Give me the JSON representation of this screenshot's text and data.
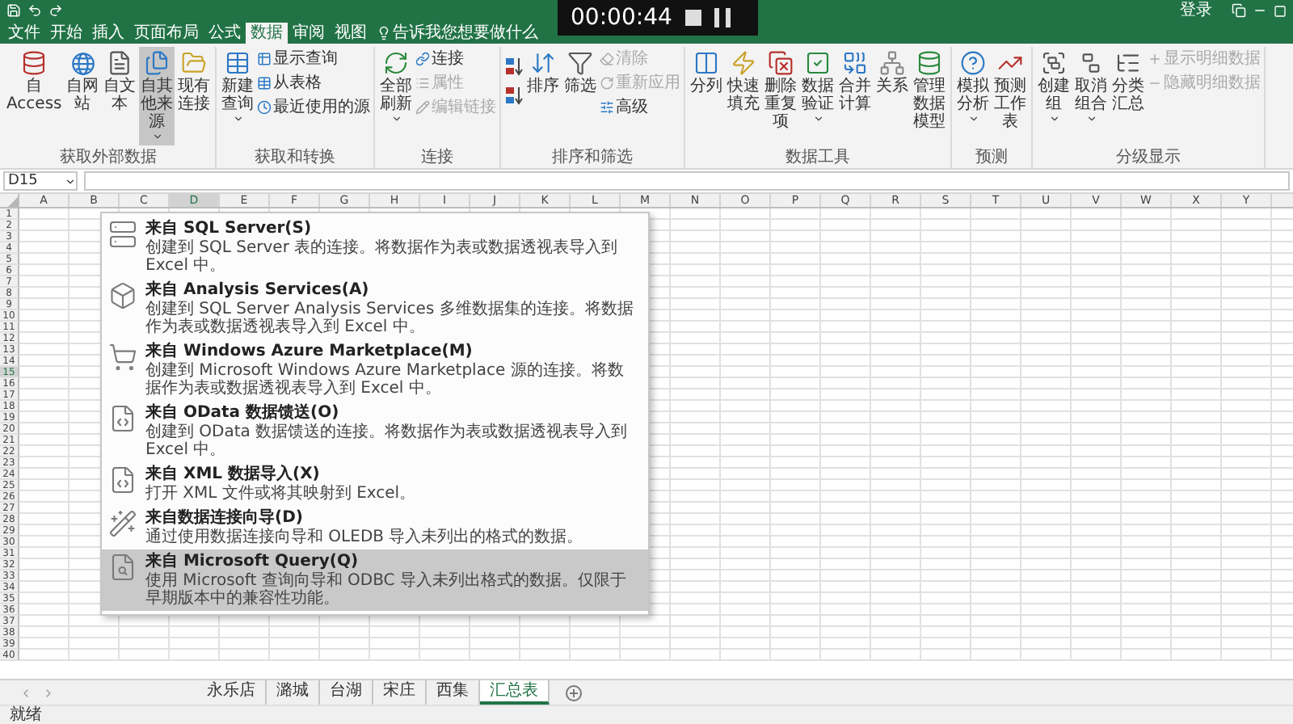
{
  "video_overlay": {
    "time": "00:00:44"
  },
  "title_bar": {
    "sign_in": "登录"
  },
  "ribbon_tabs": [
    {
      "label": "文件",
      "selected": false
    },
    {
      "label": "开始",
      "selected": false
    },
    {
      "label": "插入",
      "selected": false
    },
    {
      "label": "页面布局",
      "selected": false
    },
    {
      "label": "公式",
      "selected": false
    },
    {
      "label": "数据",
      "selected": true
    },
    {
      "label": "审阅",
      "selected": false
    },
    {
      "label": "视图",
      "selected": false
    }
  ],
  "tell_me": "告诉我您想要做什么",
  "ribbon_groups": [
    {
      "label": "获取外部数据",
      "buttons": [
        {
          "kind": "large",
          "label": "自 Access",
          "pressed": false,
          "dropdown": false
        },
        {
          "kind": "large",
          "label": "自网站",
          "pressed": false,
          "dropdown": false
        },
        {
          "kind": "large",
          "label": "自文本",
          "pressed": false,
          "dropdown": false
        },
        {
          "kind": "large",
          "label": "自其他来源",
          "pressed": true,
          "dropdown": true
        },
        {
          "kind": "large",
          "label": "现有连接",
          "pressed": false,
          "dropdown": false
        }
      ]
    },
    {
      "label": "获取和转换",
      "buttons": [
        {
          "kind": "large",
          "label": "新建查询",
          "pressed": false,
          "dropdown": true
        },
        {
          "kind": "stack",
          "items": [
            {
              "label": "显示查询",
              "disabled": false
            },
            {
              "label": "从表格",
              "disabled": false
            },
            {
              "label": "最近使用的源",
              "disabled": false
            }
          ]
        }
      ]
    },
    {
      "label": "连接",
      "buttons": [
        {
          "kind": "large",
          "label": "全部刷新",
          "pressed": false,
          "dropdown": true
        },
        {
          "kind": "stack",
          "items": [
            {
              "label": "连接",
              "disabled": false
            },
            {
              "label": "属性",
              "disabled": true
            },
            {
              "label": "编辑链接",
              "disabled": true
            }
          ]
        }
      ]
    },
    {
      "label": "排序和筛选",
      "buttons": [
        {
          "kind": "sort_pair"
        },
        {
          "kind": "large",
          "label": "排序",
          "pressed": false,
          "dropdown": false
        },
        {
          "kind": "large",
          "label": "筛选",
          "pressed": false,
          "dropdown": false
        },
        {
          "kind": "stack",
          "items": [
            {
              "label": "清除",
              "disabled": true
            },
            {
              "label": "重新应用",
              "disabled": true
            },
            {
              "label": "高级",
              "disabled": false
            }
          ]
        }
      ]
    },
    {
      "label": "数据工具",
      "buttons": [
        {
          "kind": "large",
          "label": "分列",
          "pressed": false,
          "dropdown": false
        },
        {
          "kind": "large",
          "label": "快速填充",
          "pressed": false,
          "dropdown": false
        },
        {
          "kind": "large",
          "label": "删除重复项",
          "pressed": false,
          "dropdown": false
        },
        {
          "kind": "large",
          "label": "数据验证",
          "pressed": false,
          "dropdown": true
        },
        {
          "kind": "large",
          "label": "合并计算",
          "pressed": false,
          "dropdown": false
        },
        {
          "kind": "large",
          "label": "关系",
          "pressed": false,
          "dropdown": false
        },
        {
          "kind": "large",
          "label": "管理数据模型",
          "pressed": false,
          "dropdown": false
        }
      ]
    },
    {
      "label": "预测",
      "buttons": [
        {
          "kind": "large",
          "label": "模拟分析",
          "pressed": false,
          "dropdown": true
        },
        {
          "kind": "large",
          "label": "预测工作表",
          "pressed": false,
          "dropdown": false
        }
      ]
    },
    {
      "label": "分级显示",
      "buttons": [
        {
          "kind": "large",
          "label": "创建组",
          "pressed": false,
          "dropdown": true
        },
        {
          "kind": "large",
          "label": "取消组合",
          "pressed": false,
          "dropdown": true
        },
        {
          "kind": "large",
          "label": "分类汇总",
          "pressed": false,
          "dropdown": false
        },
        {
          "kind": "stack",
          "items": [
            {
              "label": "显示明细数据",
              "disabled": true
            },
            {
              "label": "隐藏明细数据",
              "disabled": true
            }
          ]
        }
      ]
    }
  ],
  "name_box": "D15",
  "columns": [
    {
      "label": "A",
      "selected": false
    },
    {
      "label": "B",
      "selected": false
    },
    {
      "label": "C",
      "selected": false
    },
    {
      "label": "D",
      "selected": true
    },
    {
      "label": "E",
      "selected": false
    },
    {
      "label": "F",
      "selected": false
    },
    {
      "label": "G",
      "selected": false
    },
    {
      "label": "H",
      "selected": false
    },
    {
      "label": "I",
      "selected": false
    },
    {
      "label": "J",
      "selected": false
    },
    {
      "label": "K",
      "selected": false
    },
    {
      "label": "L",
      "selected": false
    },
    {
      "label": "M",
      "selected": false
    },
    {
      "label": "N",
      "selected": false
    },
    {
      "label": "O",
      "selected": false
    },
    {
      "label": "P",
      "selected": false
    },
    {
      "label": "Q",
      "selected": false
    },
    {
      "label": "R",
      "selected": false
    },
    {
      "label": "S",
      "selected": false
    },
    {
      "label": "T",
      "selected": false
    },
    {
      "label": "U",
      "selected": false
    },
    {
      "label": "V",
      "selected": false
    },
    {
      "label": "W",
      "selected": false
    },
    {
      "label": "X",
      "selected": false
    },
    {
      "label": "Y",
      "selected": false
    }
  ],
  "rows": [
    {
      "label": "1",
      "selected": false
    },
    {
      "label": "2",
      "selected": false
    },
    {
      "label": "3",
      "selected": false
    },
    {
      "label": "4",
      "selected": false
    },
    {
      "label": "5",
      "selected": false
    },
    {
      "label": "6",
      "selected": false
    },
    {
      "label": "7",
      "selected": false
    },
    {
      "label": "8",
      "selected": false
    },
    {
      "label": "9",
      "selected": false
    },
    {
      "label": "10",
      "selected": false
    },
    {
      "label": "11",
      "selected": false
    },
    {
      "label": "12",
      "selected": false
    },
    {
      "label": "13",
      "selected": false
    },
    {
      "label": "14",
      "selected": false
    },
    {
      "label": "15",
      "selected": true
    },
    {
      "label": "16",
      "selected": false
    },
    {
      "label": "17",
      "selected": false
    },
    {
      "label": "18",
      "selected": false
    },
    {
      "label": "19",
      "selected": false
    },
    {
      "label": "20",
      "selected": false
    },
    {
      "label": "21",
      "selected": false
    },
    {
      "label": "22",
      "selected": false
    },
    {
      "label": "23",
      "selected": false
    },
    {
      "label": "24",
      "selected": false
    },
    {
      "label": "25",
      "selected": false
    },
    {
      "label": "26",
      "selected": false
    },
    {
      "label": "27",
      "selected": false
    },
    {
      "label": "28",
      "selected": false
    },
    {
      "label": "29",
      "selected": false
    },
    {
      "label": "30",
      "selected": false
    },
    {
      "label": "31",
      "selected": false
    },
    {
      "label": "32",
      "selected": false
    },
    {
      "label": "33",
      "selected": false
    },
    {
      "label": "34",
      "selected": false
    },
    {
      "label": "35",
      "selected": false
    },
    {
      "label": "36",
      "selected": false
    },
    {
      "label": "37",
      "selected": false
    },
    {
      "label": "38",
      "selected": false
    },
    {
      "label": "39",
      "selected": false
    },
    {
      "label": "40",
      "selected": false
    }
  ],
  "dropdown_menu": {
    "items": [
      {
        "title": "来自 SQL Server(S)",
        "description": "创建到 SQL Server 表的连接。将数据作为表或数据透视表导入到 Excel 中。",
        "selected": false
      },
      {
        "title": "来自 Analysis Services(A)",
        "description": "创建到 SQL Server Analysis Services 多维数据集的连接。将数据作为表或数据透视表导入到 Excel 中。",
        "selected": false
      },
      {
        "title": "来自 Windows Azure Marketplace(M)",
        "description": "创建到 Microsoft Windows Azure Marketplace 源的连接。将数据作为表或数据透视表导入到 Excel 中。",
        "selected": false
      },
      {
        "title": "来自 OData 数据馈送(O)",
        "description": "创建到 OData 数据馈送的连接。将数据作为表或数据透视表导入到 Excel 中。",
        "selected": false
      },
      {
        "title": "来自 XML 数据导入(X)",
        "description": "打开 XML 文件或将其映射到 Excel。",
        "selected": false
      },
      {
        "title": "来自数据连接向导(D)",
        "description": "通过使用数据连接向导和 OLEDB 导入未列出的格式的数据。",
        "selected": false
      },
      {
        "title": "来自 Microsoft Query(Q)",
        "description": "使用 Microsoft 查询向导和 ODBC 导入未列出格式的数据。仅限于早期版本中的兼容性功能。",
        "selected": true
      }
    ]
  },
  "sheet_tabs": [
    {
      "label": "永乐店",
      "selected": false
    },
    {
      "label": "潞城",
      "selected": false
    },
    {
      "label": "台湖",
      "selected": false
    },
    {
      "label": "宋庄",
      "selected": false
    },
    {
      "label": "西集",
      "selected": false
    },
    {
      "label": "汇总表",
      "selected": true
    }
  ],
  "status_bar": {
    "text": "就绪"
  }
}
